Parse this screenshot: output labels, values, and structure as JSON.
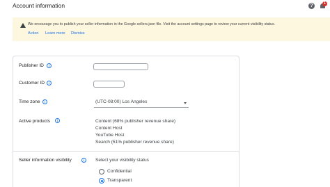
{
  "header": {
    "title": "Account information",
    "help_icon": "help-circle-icon",
    "notification_icon": "bell-icon",
    "notification_count": "1"
  },
  "banner": {
    "icon": "warning-triangle-icon",
    "message": "We encourage you to publish your seller information in the Google sellers.json file. Visit the account settings page to review your current visibility status.",
    "action_label": "Action",
    "learn_more_label": "Learn more",
    "dismiss_label": "Dismiss",
    "background_color": "#fef7e0"
  },
  "form": {
    "publisher_id": {
      "label": "Publisher ID",
      "value": ""
    },
    "customer_id": {
      "label": "Customer ID",
      "value": ""
    },
    "time_zone": {
      "label": "Time zone",
      "value": "(UTC-08:00) Los Angeles"
    },
    "active_products": {
      "label": "Active products",
      "items": [
        "Content (68% publisher revenue share)",
        "Content Host",
        "YouTube Host",
        "Search (51% publisher revenue share)"
      ]
    },
    "seller_visibility": {
      "label": "Seller information visibility",
      "prompt": "Select your visibility status",
      "options": [
        {
          "label": "Confidential",
          "selected": false
        },
        {
          "label": "Transparent",
          "selected": true
        }
      ]
    }
  },
  "colors": {
    "accent": "#1a73e8",
    "badge": "#d93025"
  }
}
